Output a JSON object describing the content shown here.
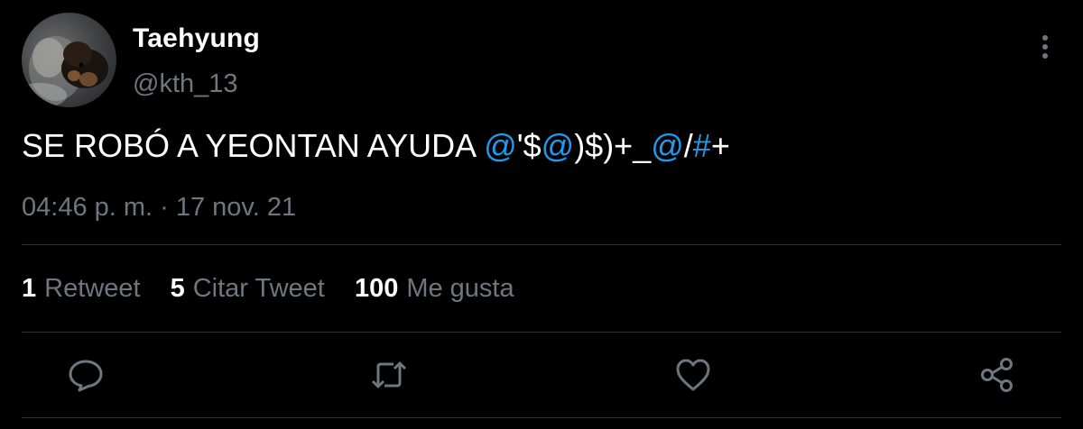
{
  "author": {
    "display_name": "Taehyung",
    "handle": "@kth_13",
    "avatar_icon": "avatar-photo-icon"
  },
  "tweet": {
    "text_parts": [
      {
        "text": "SE ROBÓ A YEONTAN AYUDA ",
        "type": "plain"
      },
      {
        "text": "@",
        "type": "mention"
      },
      {
        "text": "'$",
        "type": "plain"
      },
      {
        "text": "@",
        "type": "mention"
      },
      {
        "text": ")$)+_",
        "type": "plain"
      },
      {
        "text": "@",
        "type": "mention"
      },
      {
        "text": "/",
        "type": "plain"
      },
      {
        "text": "#",
        "type": "mention"
      },
      {
        "text": "+",
        "type": "plain"
      }
    ],
    "timestamp": "04:46 p. m. · 17 nov. 21"
  },
  "stats": [
    {
      "count": "1",
      "label": "Retweet"
    },
    {
      "count": "5",
      "label": "Citar Tweet"
    },
    {
      "count": "100",
      "label": "Me gusta"
    }
  ],
  "actions": [
    "reply-icon",
    "retweet-icon",
    "like-icon",
    "share-icon"
  ],
  "colors": {
    "background": "#000000",
    "primary_text": "#ffffff",
    "secondary_text": "#6e7680",
    "link": "#1d9bf0",
    "divider": "#2f3336"
  }
}
